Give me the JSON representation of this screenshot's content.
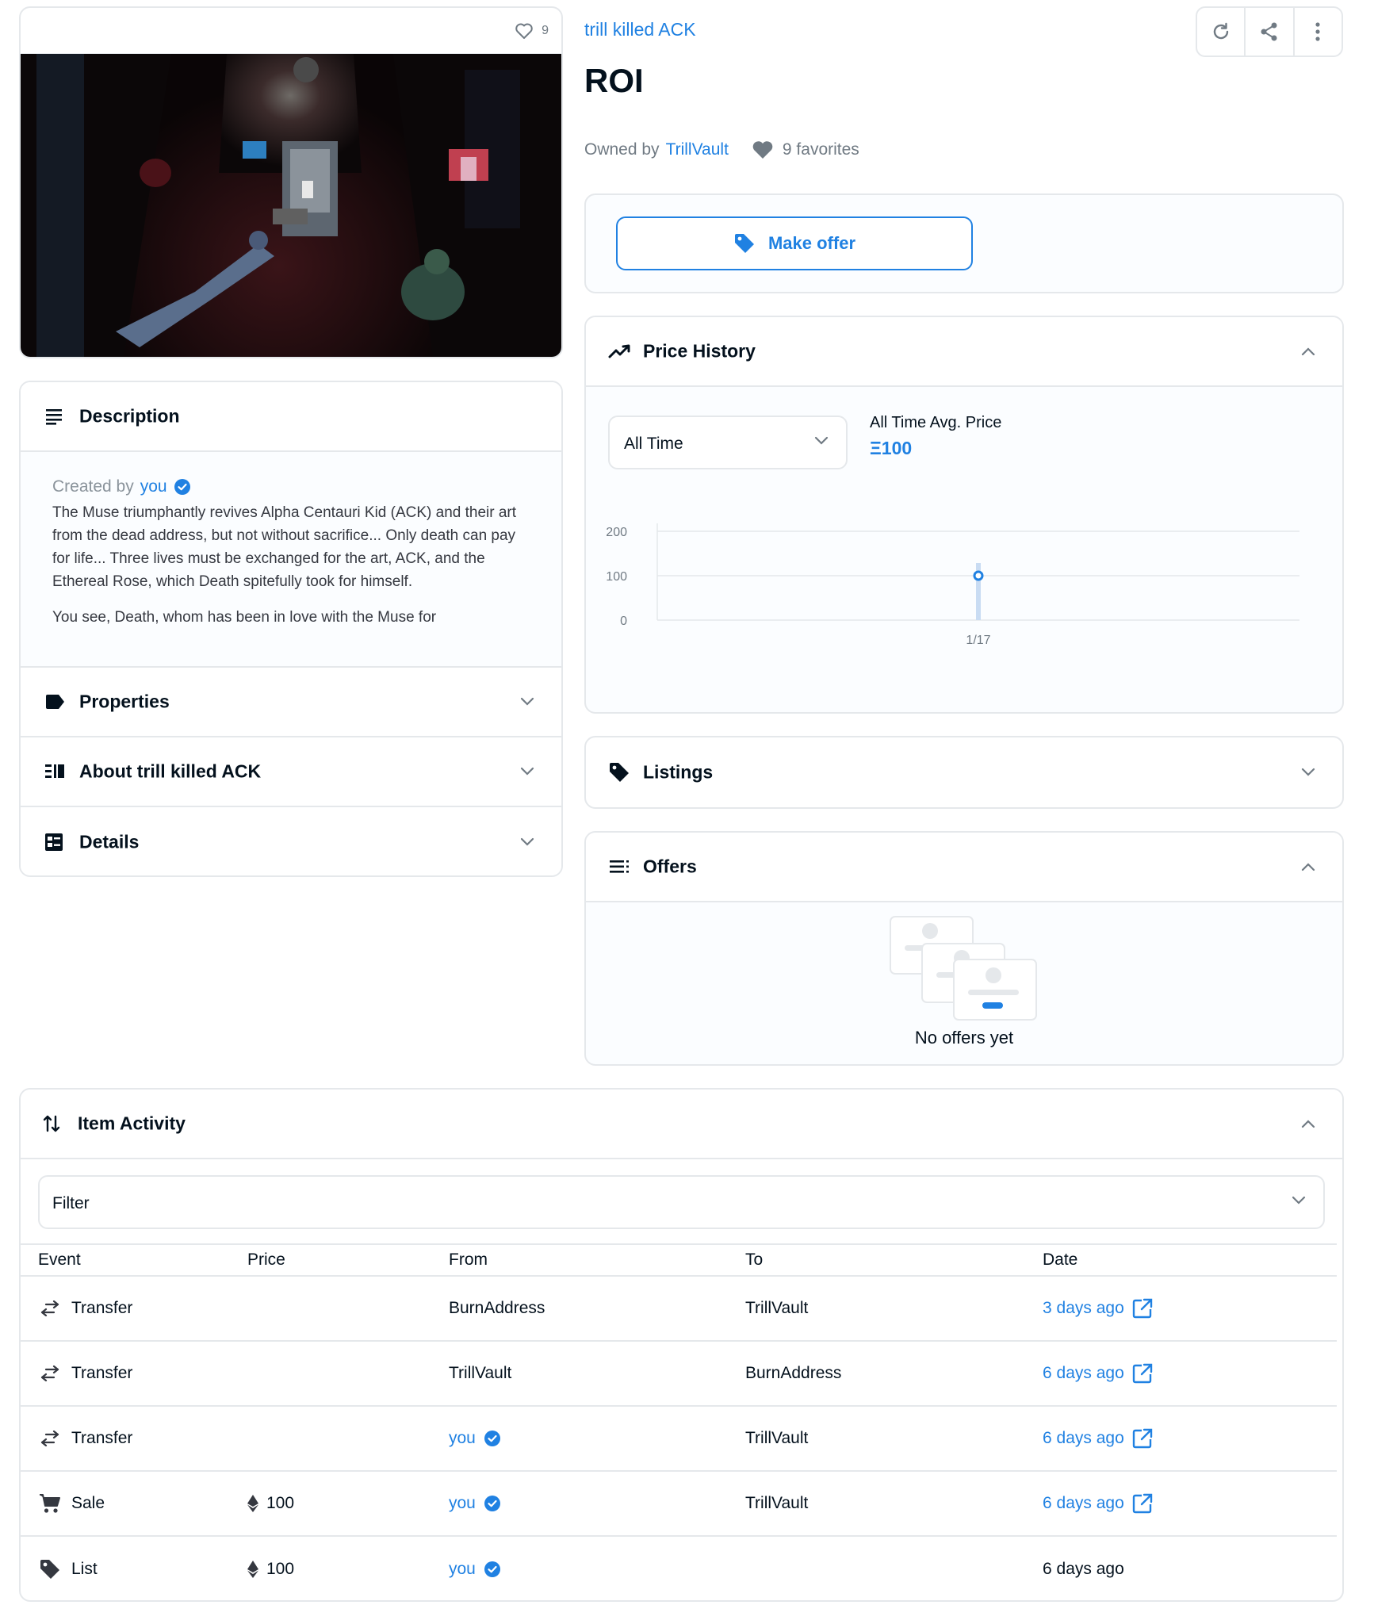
{
  "item": {
    "favorites_count": "9",
    "collection_name": "trill killed ACK",
    "title": "ROI",
    "owned_by_label": "Owned by",
    "owner": "TrillVault",
    "favorites_label": "9 favorites"
  },
  "toolbar": {
    "refresh_icon": "refresh-icon",
    "share_icon": "share-icon",
    "more_icon": "more-vertical-icon"
  },
  "description": {
    "header": "Description",
    "created_by_label": "Created by",
    "creator": "you",
    "paragraph1": "The Muse triumphantly revives Alpha Centauri Kid (ACK) and their art from the dead address, but not without sacrifice... Only death can pay for life... Three lives must be exchanged for the art, ACK, and the Ethereal Rose, which Death spitefully took for himself.",
    "paragraph2": "You see, Death, whom has been in love with the Muse for"
  },
  "left_sections": [
    {
      "label": "Properties",
      "icon": "tag-label-icon"
    },
    {
      "label": "About trill killed ACK",
      "icon": "list-detail-icon"
    },
    {
      "label": "Details",
      "icon": "details-grid-icon"
    }
  ],
  "offer": {
    "button_label": "Make offer"
  },
  "price_history": {
    "header": "Price History",
    "range_selected": "All Time",
    "avg_label": "All Time Avg. Price",
    "avg_value": "Ξ100"
  },
  "chart_data": {
    "type": "scatter",
    "x": [
      "1/17"
    ],
    "y": [
      100
    ],
    "yticks": [
      "200",
      "100",
      "0"
    ],
    "ylim": [
      0,
      200
    ],
    "grid": true
  },
  "listings": {
    "header": "Listings"
  },
  "offers": {
    "header": "Offers",
    "empty_text": "No offers yet"
  },
  "activity": {
    "header": "Item Activity",
    "filter_placeholder": "Filter",
    "columns": [
      "Event",
      "Price",
      "From",
      "To",
      "Date"
    ],
    "rows": [
      {
        "event": "Transfer",
        "icon": "transfer-icon",
        "price": "",
        "from": "BurnAddress",
        "from_verified": false,
        "to": "TrillVault",
        "date": "3 days ago",
        "date_link": true
      },
      {
        "event": "Transfer",
        "icon": "transfer-icon",
        "price": "",
        "from": "TrillVault",
        "from_verified": false,
        "to": "BurnAddress",
        "date": "6 days ago",
        "date_link": true
      },
      {
        "event": "Transfer",
        "icon": "transfer-icon",
        "price": "",
        "from": "you",
        "from_verified": true,
        "to": "TrillVault",
        "date": "6 days ago",
        "date_link": true
      },
      {
        "event": "Sale",
        "icon": "cart-icon",
        "price": "100",
        "from": "you",
        "from_verified": true,
        "to": "TrillVault",
        "date": "6 days ago",
        "date_link": true
      },
      {
        "event": "List",
        "icon": "tag-icon",
        "price": "100",
        "from": "you",
        "from_verified": true,
        "to": "",
        "date": "6 days ago",
        "date_link": false
      }
    ]
  },
  "colors": {
    "accent": "#2081e2",
    "text": "#04111d",
    "muted": "#707a83",
    "border": "#e5e8eb"
  }
}
